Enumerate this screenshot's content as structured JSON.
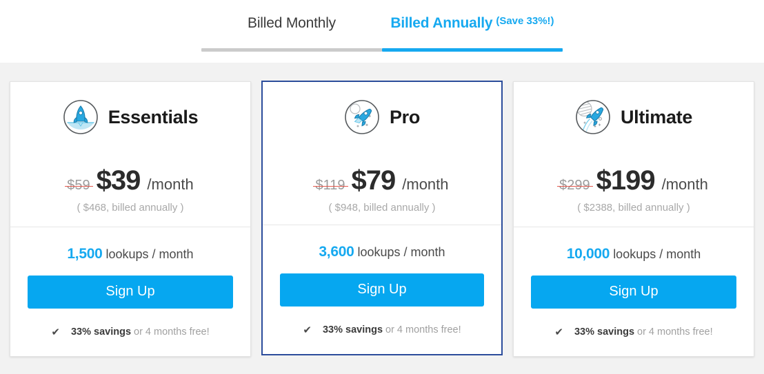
{
  "billing": {
    "tabs": [
      {
        "label": "Billed Monthly",
        "save_note": "",
        "active": false
      },
      {
        "label": "Billed Annually",
        "save_note": "(Save 33%!)",
        "active": true
      }
    ]
  },
  "colors": {
    "accent_blue": "#06a7f0",
    "featured_border": "#2b4c9b",
    "strike_red": "#e2574c",
    "page_bg": "#f2f2f2",
    "muted_text": "#a8a8a8"
  },
  "plans": [
    {
      "name": "Essentials",
      "icon": "rocket-launch-icon",
      "old_price": "$59",
      "price": "$39",
      "period": "/month",
      "billed_note": "( $468, billed annually )",
      "lookups_count": "1,500",
      "lookups_label": "lookups / month",
      "cta_label": "Sign Up",
      "savings_strong": "33% savings",
      "savings_rest": "or 4 months free!",
      "featured": false
    },
    {
      "name": "Pro",
      "icon": "rocket-flying-icon",
      "old_price": "$119",
      "price": "$79",
      "period": "/month",
      "billed_note": "( $948, billed annually )",
      "lookups_count": "3,600",
      "lookups_label": "lookups / month",
      "cta_label": "Sign Up",
      "savings_strong": "33% savings",
      "savings_rest": "or 4 months free!",
      "featured": true
    },
    {
      "name": "Ultimate",
      "icon": "rocket-orbit-icon",
      "old_price": "$299",
      "price": "$199",
      "period": "/month",
      "billed_note": "( $2388, billed annually )",
      "lookups_count": "10,000",
      "lookups_label": "lookups / month",
      "cta_label": "Sign Up",
      "savings_strong": "33% savings",
      "savings_rest": "or 4 months free!",
      "featured": false
    }
  ],
  "icons": {
    "check": "✔"
  }
}
